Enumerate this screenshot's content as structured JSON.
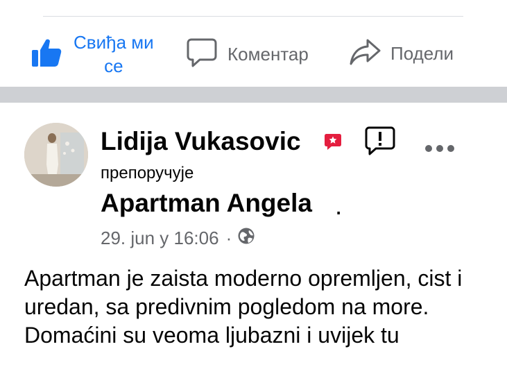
{
  "actions": {
    "like_line1": "Свиђа ми",
    "like_line2": "се",
    "comment_label": "Коментар",
    "share_label": "Подели"
  },
  "post": {
    "author": "Lidija Vukasovic",
    "action": "препоручује",
    "page_name": "Apartman Angela",
    "period": ".",
    "date": "29. jun у 16:06",
    "separator": "·",
    "body_line1": "Apartman je zaista moderno opremljen, cist i uredan, sa predivnim pogledom na more.",
    "body_line2": "Domaćini su veoma ljubazni i uvijek tu"
  },
  "colors": {
    "accent": "#1877f2",
    "secondary_text": "#65676b",
    "recommend_badge": "#e41e3f",
    "divider": "#ced0d4"
  },
  "icons": {
    "like": "thumbs-up-icon",
    "comment": "comment-icon",
    "share": "share-icon",
    "badge": "recommendation-icon",
    "report": "report-icon",
    "more": "more-options-icon",
    "privacy": "globe-icon"
  }
}
